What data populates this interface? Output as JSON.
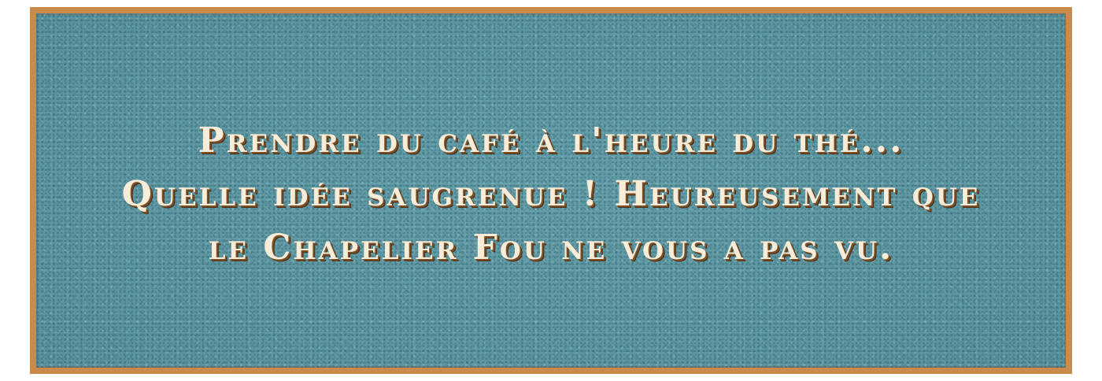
{
  "banner": {
    "lines": [
      "Prendre du café à l'heure du thé...",
      "Quelle idée saugrenue ! Heureusement que",
      "le Chapelier Fou ne vous a pas vu."
    ],
    "colors": {
      "background": "#5e99a5",
      "border": "#c98a4b",
      "text": "#f7ecd8",
      "text_shadow": "#7a4f26"
    }
  }
}
